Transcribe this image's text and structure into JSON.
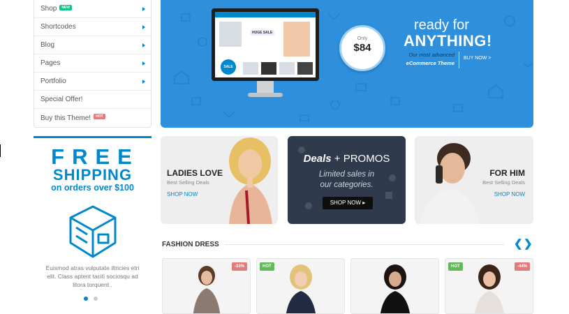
{
  "menu": {
    "items": [
      {
        "label": "Shop",
        "badge": "NEW",
        "badge_type": "new",
        "arrow": true
      },
      {
        "label": "Shortcodes",
        "badge": "",
        "arrow": true
      },
      {
        "label": "Blog",
        "badge": "",
        "arrow": true
      },
      {
        "label": "Pages",
        "badge": "",
        "arrow": true
      },
      {
        "label": "Portfolio",
        "badge": "",
        "arrow": true
      },
      {
        "label": "Special Offer!",
        "badge": "",
        "arrow": false
      },
      {
        "label": "Buy this Theme!",
        "badge": "HOT",
        "badge_type": "hot",
        "arrow": false
      }
    ]
  },
  "hero": {
    "screen_huge": "HUGE SALE",
    "screen_sale": "SALE",
    "price_only": "Only",
    "price": "$84",
    "ready": "ready for",
    "anything": "ANYTHING!",
    "tagline_1": "Our most advanced",
    "tagline_2": "eCommerce Theme",
    "buy_now": "BUY NOW >"
  },
  "free_shipping": {
    "free": "FREE",
    "shipping": "SHIPPING",
    "orders": "on orders over $100",
    "text": "Euismod atras vulputate iltricies etri elit. Class aptent taciti sociosqu ad litora torquent ."
  },
  "promos": {
    "left": {
      "title": "LADIES LOVE",
      "sub": "Best Selling Deals",
      "link": "SHOP NOW"
    },
    "mid": {
      "title_bold": "Deals",
      "title_rest": " + PROMOS",
      "line1": "Limited sales in",
      "line2": "our categories.",
      "button": "SHOP NOW ▸"
    },
    "right": {
      "title": "FOR HIM",
      "sub": "Best Selling Deals",
      "link": "SHOP NOW"
    }
  },
  "fashion": {
    "title": "FASHION DRESS",
    "prev": "❮",
    "next": "❯",
    "products": [
      {
        "tag": "-33%",
        "tag_type": "sale"
      },
      {
        "tag": "HOT",
        "tag_type": "hot"
      },
      {
        "tag": "",
        "tag_type": ""
      },
      {
        "tag": "HOT",
        "tag_type": "hot",
        "tag2": "-44%"
      }
    ]
  },
  "colors": {
    "accent": "#0088cc",
    "hero_bg": "#2e8fdc",
    "promo_dark": "#2f3b4c",
    "new_badge": "#0cc485",
    "hot_badge": "#e27c7c",
    "hot_tag": "#62b959"
  }
}
